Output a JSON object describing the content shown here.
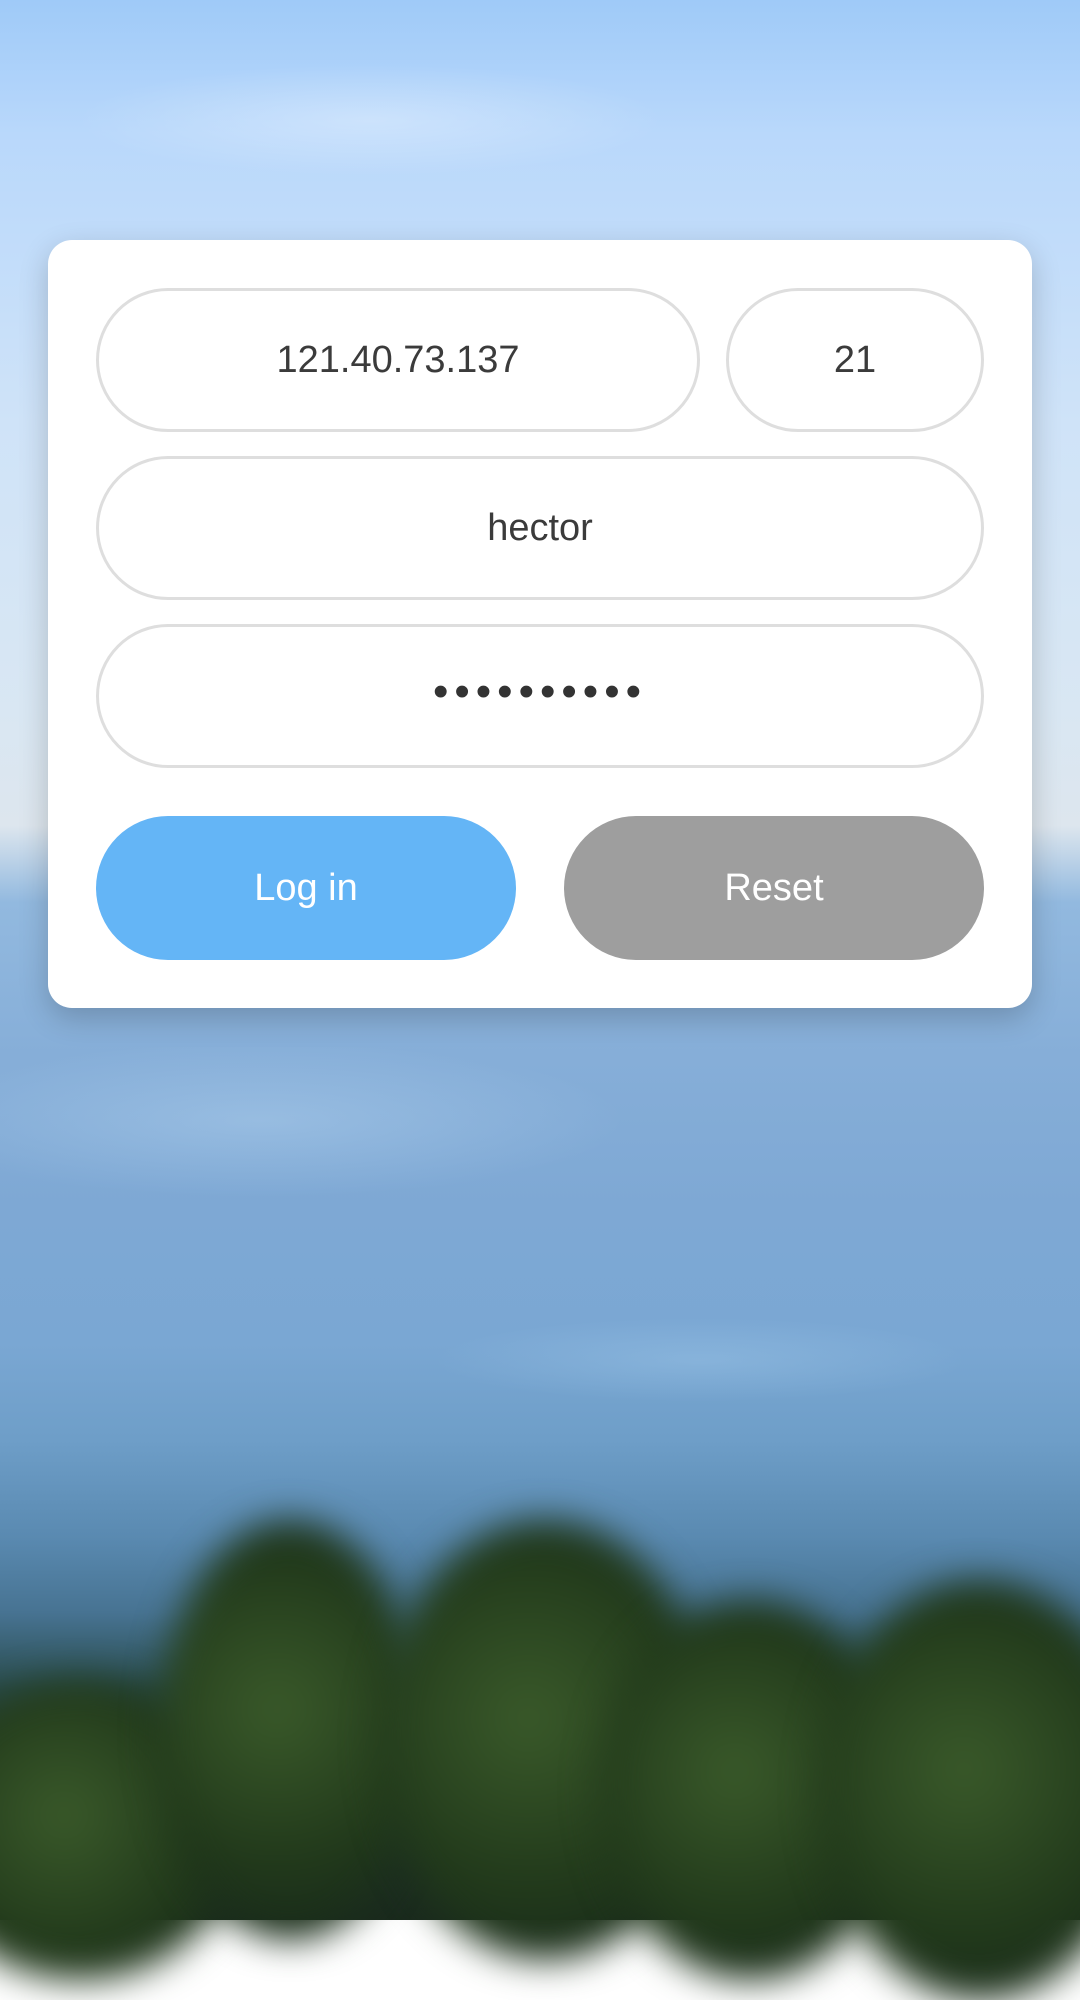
{
  "login_form": {
    "host": "121.40.73.137",
    "port": "21",
    "username": "hector",
    "password_masked": "••••••••••"
  },
  "buttons": {
    "login_label": "Log in",
    "reset_label": "Reset"
  },
  "colors": {
    "login_button": "#64b5f6",
    "reset_button": "#9e9e9e",
    "field_border": "#dedede"
  }
}
